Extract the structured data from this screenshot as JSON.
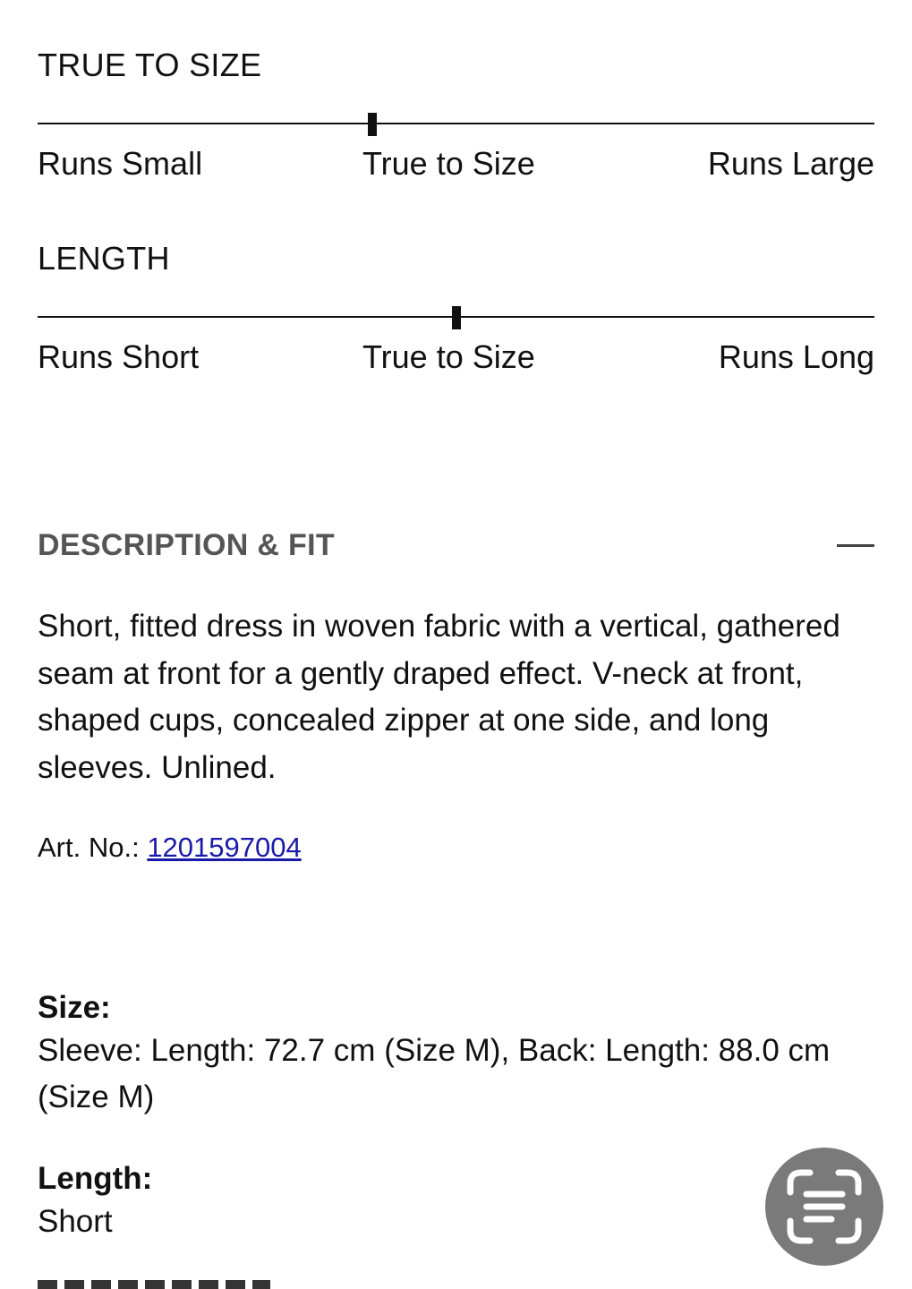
{
  "fit_scales": [
    {
      "title": "TRUE TO SIZE",
      "left_label": "Runs Small",
      "center_label": "True to Size",
      "right_label": "Runs Large",
      "position_fraction": 0.4
    },
    {
      "title": "LENGTH",
      "left_label": "Runs Short",
      "center_label": "True to Size",
      "right_label": "Runs Long",
      "position_fraction": 0.5
    }
  ],
  "description_section": {
    "header": "DESCRIPTION & FIT",
    "collapse_icon": "minus-icon",
    "text": "Short, fitted dress in woven fabric with a vertical, gathered seam at front for a gently draped effect. V-neck at front, shaped cups, concealed zipper at one side, and long sleeves. Unlined.",
    "art_no_label": "Art. No.: ",
    "art_no_value": "1201597004"
  },
  "specs": {
    "size_title": "Size:",
    "size_value": "Sleeve: Length: 72.7 cm (Size M), Back: Length: 88.0 cm (Size M)",
    "length_title": "Length:",
    "length_value": "Short"
  },
  "floating_button": {
    "icon": "text-scan-icon",
    "color": "#7a7a7a"
  },
  "colors": {
    "text": "#111111",
    "header_gray": "#555555",
    "link": "#1a1aa8"
  }
}
